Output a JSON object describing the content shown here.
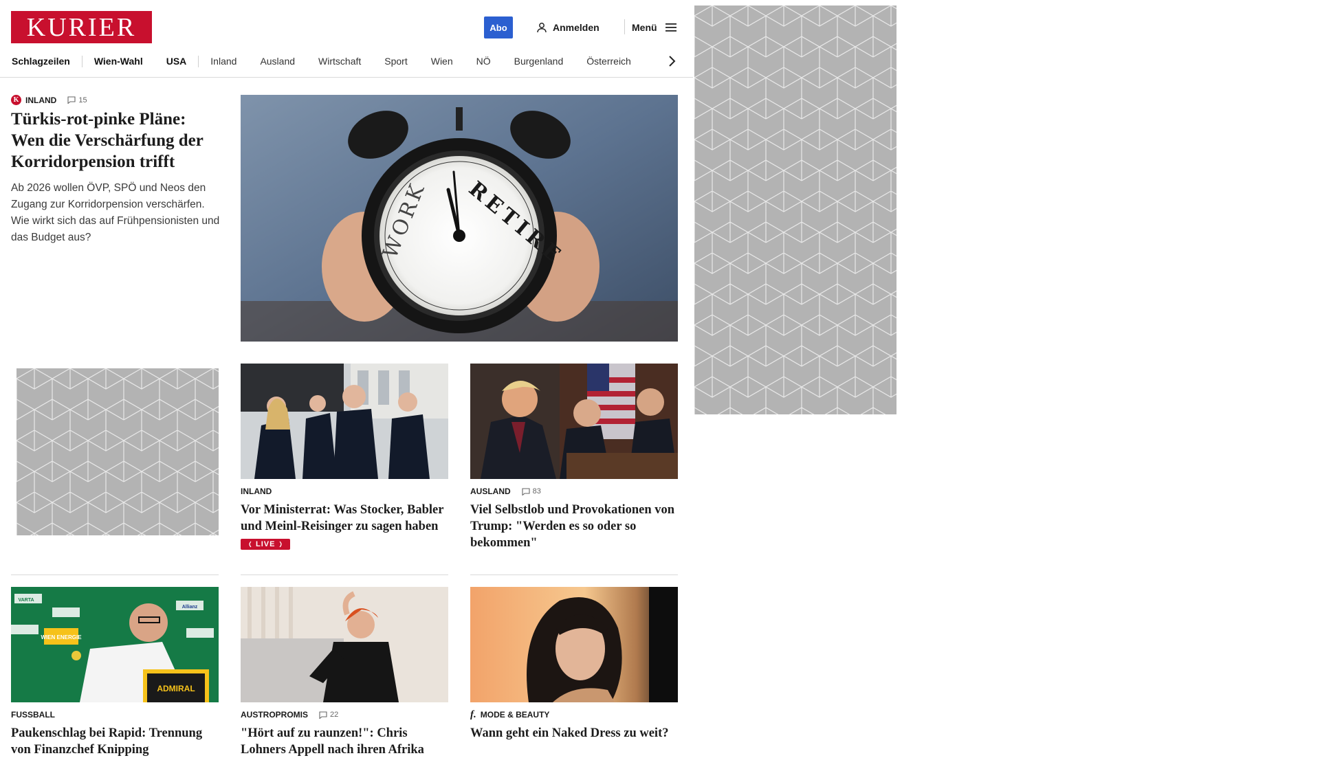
{
  "header": {
    "logo": "KURIER",
    "abo_label": "Abo",
    "login_label": "Anmelden",
    "menu_label": "Menü"
  },
  "nav": {
    "items": [
      "Schlagzeilen",
      "Wien-Wahl",
      "USA",
      "Inland",
      "Ausland",
      "Wirtschaft",
      "Sport",
      "Wien",
      "NÖ",
      "Burgenland",
      "Österreich"
    ]
  },
  "hero": {
    "category": "INLAND",
    "comments": "15",
    "title": "Türkis-rot-pinke Pläne: Wen die Verschärfung der Korridorpension trifft",
    "teaser": "Ab 2026 wollen ÖVP, SPÖ und Neos den Zugang zur Korridorpension verschärfen. Wie wirkt sich das auf Frühpensionisten und das Budget aus?",
    "image_words": [
      "WORK",
      "RETIRE"
    ]
  },
  "cards": [
    {
      "category": "INLAND",
      "comments": "",
      "title": "Vor Ministerrat: Was Stocker, Babler und Meinl-Reisinger zu sagen haben",
      "badge": "LIVE"
    },
    {
      "category": "AUSLAND",
      "comments": "83",
      "title": "Viel Selbstlob und Provokationen von Trump: \"Werden es so oder so bekommen\"",
      "badge": ""
    },
    {
      "category": "FUSSBALL",
      "comments": "",
      "title": "Paukenschlag bei Rapid: Trennung von Finanzchef Knipping",
      "badge": ""
    },
    {
      "category": "AUSTROPROMIS",
      "comments": "22",
      "title": "\"Hört auf zu raunzen!\": Chris Lohners Appell nach ihren Afrika",
      "badge": ""
    },
    {
      "category": "MODE & BEAUTY",
      "comments": "",
      "title": "Wann geht ein Naked Dress zu weit?",
      "badge": ""
    }
  ],
  "sponsor_signs": [
    "WIEN ENERGIE",
    "ADMIRAL",
    "VARTA",
    "Allianz"
  ],
  "colors": {
    "brand_red": "#c8102e",
    "abo_blue": "#2b5fd0",
    "ad_gray": "#b3b3b3"
  }
}
